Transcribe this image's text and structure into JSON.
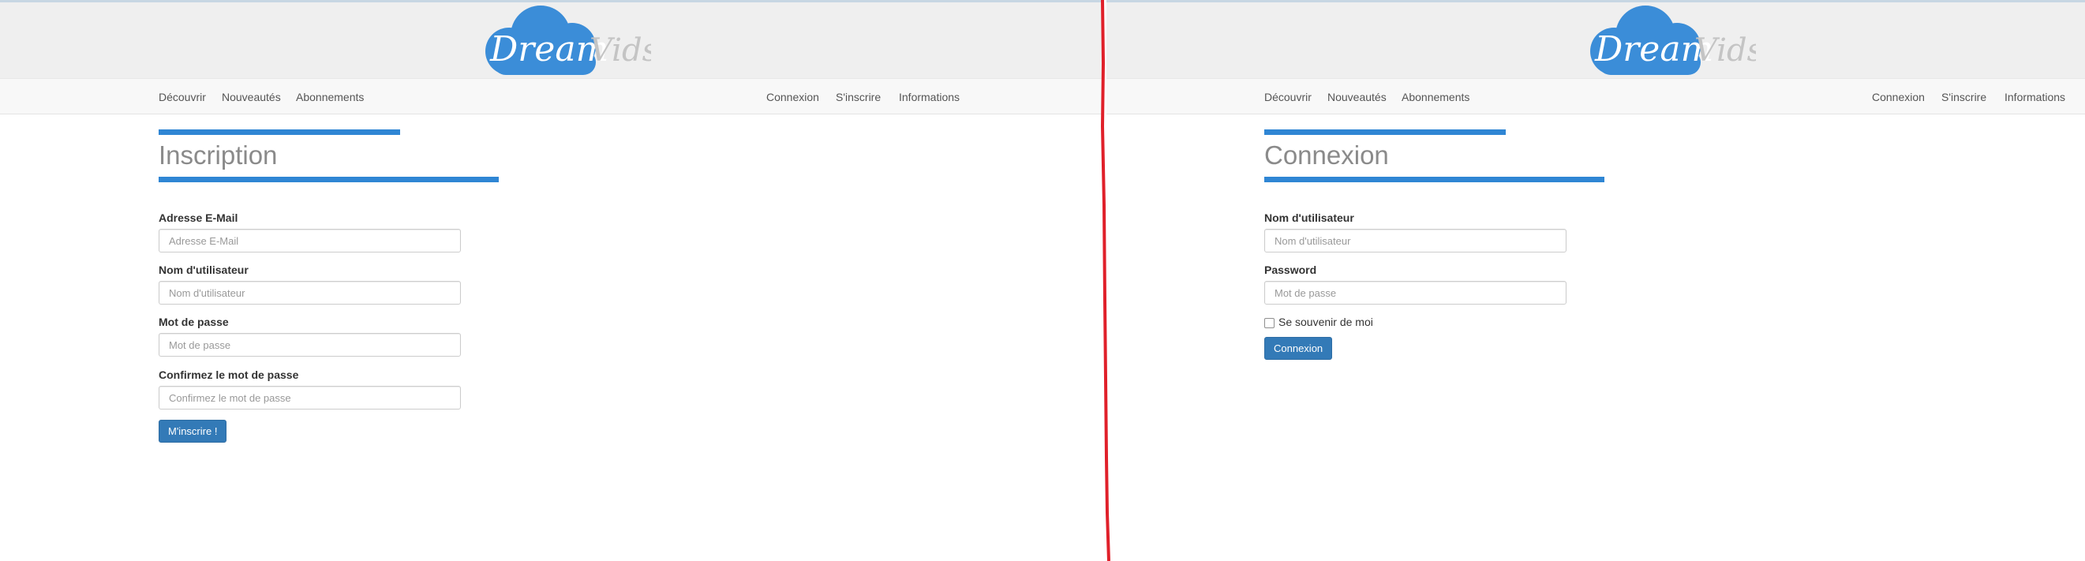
{
  "brand": {
    "logo_text_main": "Dream",
    "logo_text_secondary": "Vids",
    "cloud_color": "#3b8dd8"
  },
  "colors": {
    "accent": "#2f86d4",
    "button": "#337ab7",
    "divider": "#e0202a"
  },
  "left_page": {
    "nav_left": [
      "Découvrir",
      "Nouveautés",
      "Abonnements"
    ],
    "nav_right": [
      "Connexion",
      "S'inscrire",
      "Informations"
    ],
    "title": "Inscription",
    "fields": [
      {
        "label": "Adresse E-Mail",
        "placeholder": "Adresse E-Mail"
      },
      {
        "label": "Nom d'utilisateur",
        "placeholder": "Nom d'utilisateur"
      },
      {
        "label": "Mot de passe",
        "placeholder": "Mot de passe"
      },
      {
        "label": "Confirmez le mot de passe",
        "placeholder": "Confirmez le mot de passe"
      }
    ],
    "submit_label": "M'inscrire !"
  },
  "right_page": {
    "nav_left": [
      "Découvrir",
      "Nouveautés",
      "Abonnements"
    ],
    "nav_right": [
      "Connexion",
      "S'inscrire",
      "Informations"
    ],
    "title": "Connexion",
    "fields": [
      {
        "label": "Nom d'utilisateur",
        "placeholder": "Nom d'utilisateur"
      },
      {
        "label": "Password",
        "placeholder": "Mot de passe"
      }
    ],
    "remember_label": "Se souvenir de moi",
    "submit_label": "Connexion"
  }
}
